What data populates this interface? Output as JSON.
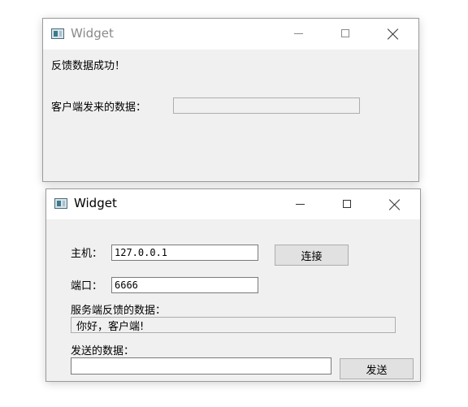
{
  "server_window": {
    "title": "Widget",
    "status_text": "反馈数据成功！",
    "received_label": "客户端发来的数据：",
    "received_value": ""
  },
  "client_window": {
    "title": "Widget",
    "host_label": "主机：",
    "host_value": "127.0.0.1",
    "connect_label": "连接",
    "port_label": "端口：",
    "port_value": "6666",
    "feedback_label": "服务端反馈的数据：",
    "feedback_value": "你好，客户端!",
    "send_label": "发送的数据：",
    "send_value": "",
    "send_button": "发送"
  },
  "icons": {
    "app": "app-window-icon",
    "minimize": "minimize-icon",
    "maximize": "maximize-icon",
    "close": "close-icon"
  }
}
